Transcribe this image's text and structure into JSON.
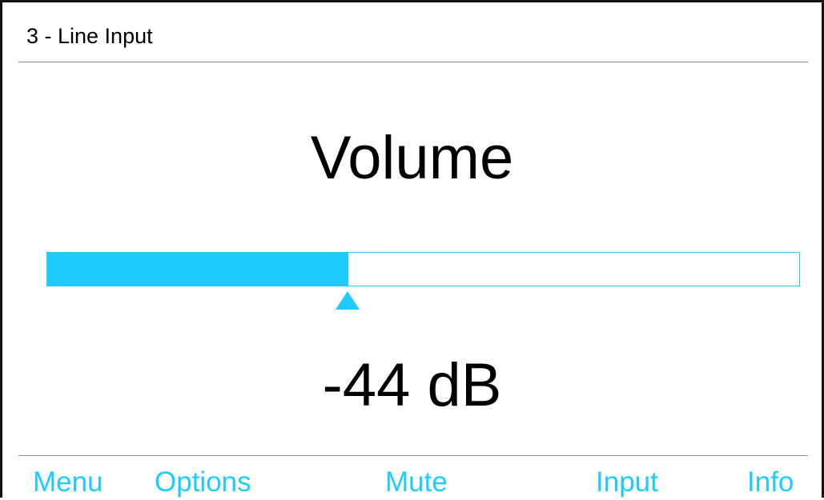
{
  "header": {
    "title": "3 - Line Input"
  },
  "main": {
    "title": "Volume",
    "volume": {
      "level_fraction": 0.4,
      "readout": "-44 dB"
    }
  },
  "softkeys": {
    "menu": "Menu",
    "options": "Options",
    "mute": "Mute",
    "input": "Input",
    "info": "Info"
  },
  "colors": {
    "accent": "#1ecbfc",
    "text": "#000000",
    "background": "#ffffff",
    "divider": "#8c8c8c"
  }
}
